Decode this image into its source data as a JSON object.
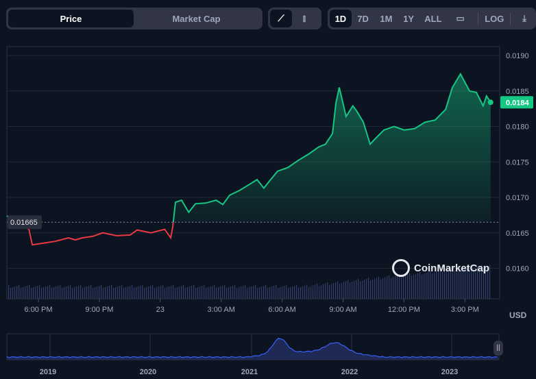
{
  "toolbar": {
    "view_tabs": [
      "Price",
      "Market Cap"
    ],
    "active_view": "Price",
    "chart_types": [
      {
        "icon": "line-chart-icon",
        "active": true
      },
      {
        "icon": "candlestick-icon",
        "active": false
      }
    ],
    "ranges": [
      "1D",
      "7D",
      "1M",
      "1Y",
      "ALL"
    ],
    "active_range": "1D",
    "calendar_icon": "calendar-icon",
    "log_label": "LOG",
    "download_icon": "download-icon"
  },
  "colors": {
    "up": "#16c784",
    "down": "#ea3943",
    "volume": "#3c4a80",
    "navigator": "#3861fb"
  },
  "watermark": "CoinMarketCap",
  "currency": "USD",
  "chart_data": {
    "type": "line",
    "title": "",
    "xlabel": "",
    "ylabel": "",
    "ylim": [
      0.01555,
      0.01915
    ],
    "yticks": [
      "0.0190",
      "0.0185",
      "0.0180",
      "0.0175",
      "0.0170",
      "0.0165",
      "0.0160"
    ],
    "xticks": [
      "6:00 PM",
      "9:00 PM",
      "23",
      "3:00 AM",
      "6:00 AM",
      "9:00 AM",
      "12:00 PM",
      "3:00 PM"
    ],
    "baseline": 0.01665,
    "baseline_label": "0.01665",
    "current_label": "0.0184",
    "grid": true,
    "points": [
      [
        "22 16:27",
        0.01674
      ],
      [
        "22 16:35",
        0.01671
      ],
      [
        "22 17:32",
        0.01655
      ],
      [
        "22 17:42",
        0.01633
      ],
      [
        "22 18:08",
        0.01635
      ],
      [
        "22 18:49",
        0.01638
      ],
      [
        "22 19:29",
        0.01643
      ],
      [
        "22 19:49",
        0.0164
      ],
      [
        "22 20:10",
        0.01643
      ],
      [
        "22 20:40",
        0.01645
      ],
      [
        "22 21:10",
        0.0165
      ],
      [
        "22 21:51",
        0.01646
      ],
      [
        "22 22:31",
        0.01647
      ],
      [
        "22 22:52",
        0.01654
      ],
      [
        "22 23:32",
        0.0165
      ],
      [
        "23 00:13",
        0.01655
      ],
      [
        "23 00:31",
        0.01643
      ],
      [
        "23 00:37",
        0.01659
      ],
      [
        "23 00:45",
        0.01693
      ],
      [
        "23 01:03",
        0.01696
      ],
      [
        "23 01:24",
        0.01679
      ],
      [
        "23 01:44",
        0.01691
      ],
      [
        "23 02:14",
        0.01692
      ],
      [
        "23 02:45",
        0.01696
      ],
      [
        "23 03:05",
        0.0169
      ],
      [
        "23 03:25",
        0.01703
      ],
      [
        "23 03:55",
        0.0171
      ],
      [
        "23 04:26",
        0.01719
      ],
      [
        "23 04:46",
        0.01725
      ],
      [
        "23 05:06",
        0.01713
      ],
      [
        "23 05:26",
        0.01725
      ],
      [
        "23 05:47",
        0.01737
      ],
      [
        "23 06:17",
        0.01742
      ],
      [
        "23 06:47",
        0.01752
      ],
      [
        "23 07:18",
        0.01761
      ],
      [
        "23 07:48",
        0.01771
      ],
      [
        "23 08:08",
        0.01775
      ],
      [
        "23 08:29",
        0.0179
      ],
      [
        "23 08:39",
        0.01833
      ],
      [
        "23 08:49",
        0.01855
      ],
      [
        "23 09:09",
        0.01814
      ],
      [
        "23 09:29",
        0.01829
      ],
      [
        "23 09:40",
        0.01822
      ],
      [
        "23 10:00",
        0.01806
      ],
      [
        "23 10:20",
        0.01775
      ],
      [
        "23 10:40",
        0.01785
      ],
      [
        "23 11:01",
        0.01795
      ],
      [
        "23 11:31",
        0.018
      ],
      [
        "23 12:01",
        0.01795
      ],
      [
        "23 12:32",
        0.01797
      ],
      [
        "23 13:02",
        0.01806
      ],
      [
        "23 13:32",
        0.01809
      ],
      [
        "23 14:03",
        0.01824
      ],
      [
        "23 14:23",
        0.01855
      ],
      [
        "23 14:47",
        0.01874
      ],
      [
        "23 15:14",
        0.0185
      ],
      [
        "23 15:34",
        0.01848
      ],
      [
        "23 15:54",
        0.01829
      ],
      [
        "23 16:04",
        0.01843
      ],
      [
        "23 16:16",
        0.01834
      ]
    ],
    "navigator_years": [
      "2019",
      "2020",
      "2021",
      "2022",
      "2023"
    ]
  }
}
